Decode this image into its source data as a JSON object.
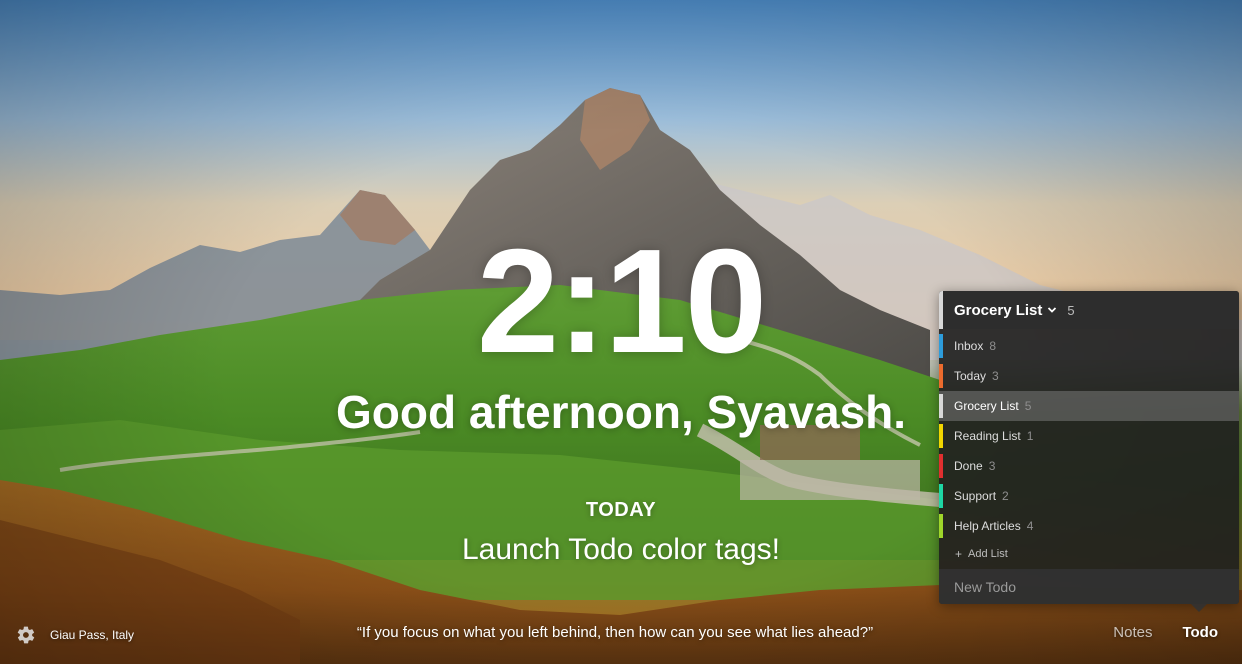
{
  "clock": {
    "time": "2:10"
  },
  "greeting": {
    "text": "Good afternoon, Syavash."
  },
  "focus": {
    "label": "TODAY",
    "task": "Launch Todo color tags!"
  },
  "footer": {
    "location": "Giau Pass, Italy",
    "quote": "“If you focus on what you left behind, then how can you see what lies ahead?”",
    "notes_label": "Notes",
    "todo_label": "Todo",
    "settings_icon": "gear-icon"
  },
  "todo_panel": {
    "header": {
      "title": "Grocery List",
      "count": "5",
      "icon": "chevron-down-icon"
    },
    "lists": [
      {
        "name": "Inbox",
        "count": "8",
        "color": "#2d9cdb"
      },
      {
        "name": "Today",
        "count": "3",
        "color": "#eb6b2d"
      },
      {
        "name": "Grocery List",
        "count": "5",
        "color": "#d8d8d8"
      },
      {
        "name": "Reading List",
        "count": "1",
        "color": "#f2d600"
      },
      {
        "name": "Done",
        "count": "3",
        "color": "#e02f2f"
      },
      {
        "name": "Support",
        "count": "2",
        "color": "#1ed7a5"
      },
      {
        "name": "Help Articles",
        "count": "4",
        "color": "#9fd62a"
      }
    ],
    "active_list": "Grocery List",
    "add_list_label": "Add List",
    "new_todo_placeholder": "New Todo"
  }
}
